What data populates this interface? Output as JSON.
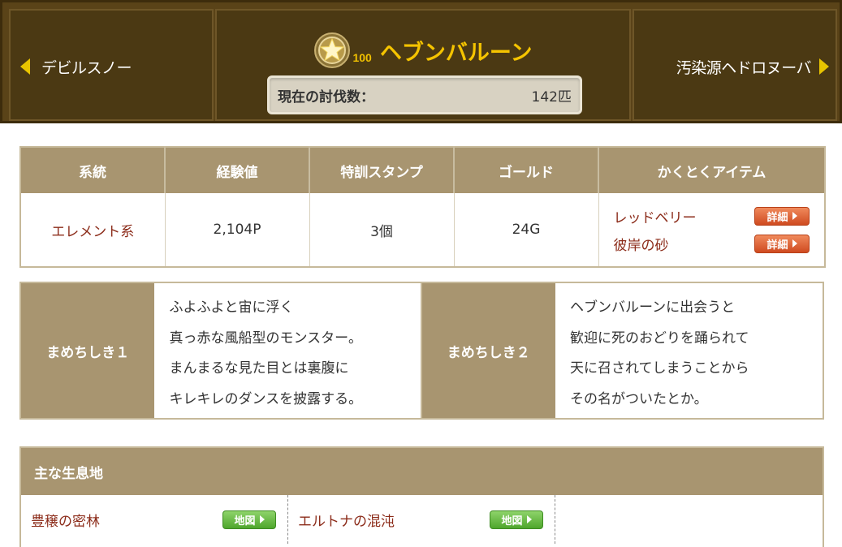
{
  "header": {
    "prev_monster": "デビルスノー",
    "next_monster": "汚染源ヘドロヌーバ",
    "rank": "100",
    "monster_name": "ヘブンバルーン",
    "kill_count_label": "現在の討伐数：",
    "kill_count_value": "142匹"
  },
  "info": {
    "headers": [
      "系統",
      "経験値",
      "特訓スタンプ",
      "ゴールド",
      "かくとくアイテム"
    ],
    "family": "エレメント系",
    "exp": "2,104P",
    "stamps": "3個",
    "gold": "24G",
    "items": [
      {
        "name": "レッドベリー",
        "button": "詳細"
      },
      {
        "name": "彼岸の砂",
        "button": "詳細"
      }
    ]
  },
  "trivia": {
    "label1": "まめちしき１",
    "text1": [
      "ふよふよと宙に浮く",
      "真っ赤な風船型のモンスター。",
      "まんまるな見た目とは裏腹に",
      "キレキレのダンスを披露する。"
    ],
    "label2": "まめちしき２",
    "text2": [
      "ヘブンバルーンに出会うと",
      "歓迎に死のおどりを踊られて",
      "天に召されてしまうことから",
      "その名がついたとか。"
    ]
  },
  "habitat": {
    "title": "主な生息地",
    "places": [
      {
        "name": "豊穣の密林",
        "button": "地図"
      },
      {
        "name": "エルトナの混沌",
        "button": "地図"
      }
    ]
  },
  "colors": {
    "header_bg": "#5a4318",
    "title_gold": "#f5c400",
    "table_head": "#a89570",
    "link_red": "#8c2c1a",
    "detail_btn": "#e0643a",
    "map_btn": "#62b83c"
  },
  "icons": {
    "rank": "gold-star-medal-icon",
    "prev": "triangle-left-icon",
    "next": "triangle-right-icon"
  }
}
